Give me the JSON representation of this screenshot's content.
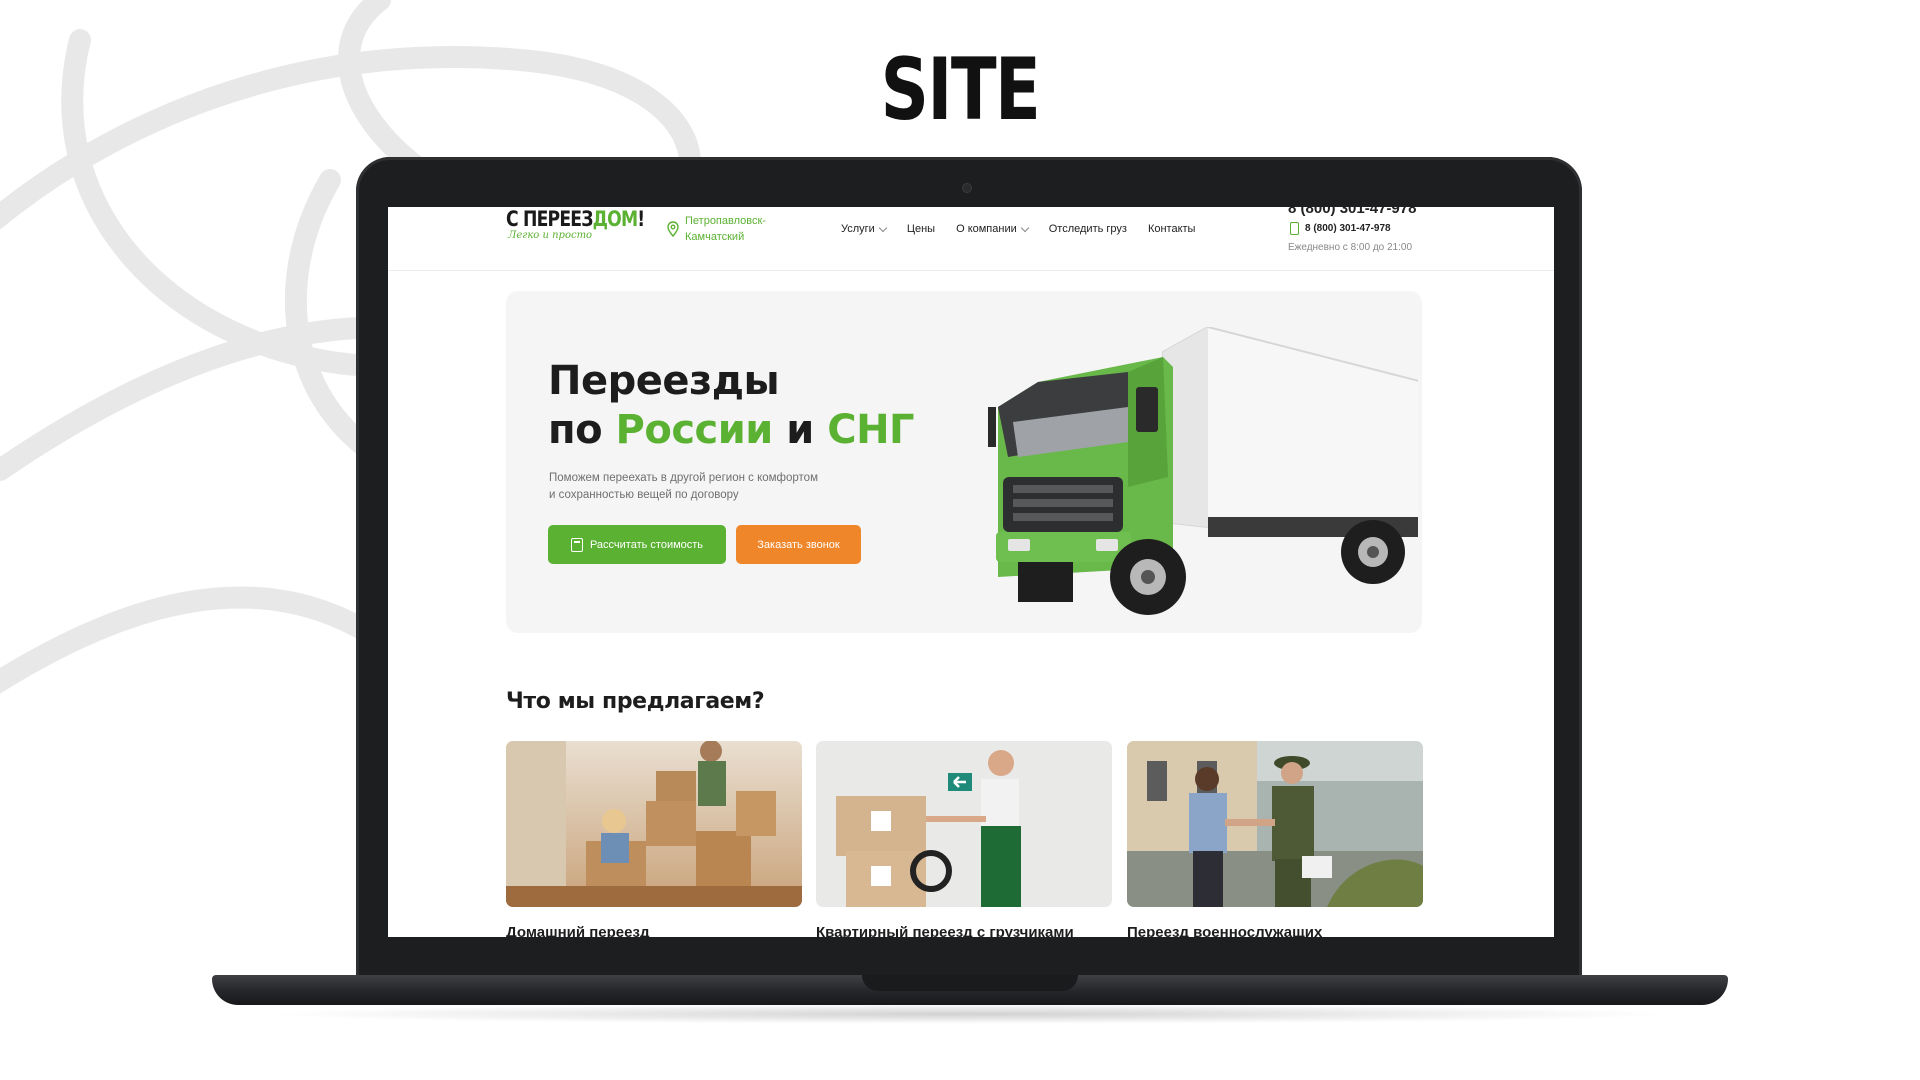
{
  "showcase": {
    "title": "SITE"
  },
  "site": {
    "logo": {
      "text_prefix": "С ПЕРЕЕЗ",
      "text_accent": "ДОМ",
      "text_suffix": "!",
      "tagline": "Легко и просто"
    },
    "location": {
      "city_line1": "Петропавловск-",
      "city_line2": "Камчатский"
    },
    "nav": [
      {
        "label": "Услуги",
        "dropdown": true
      },
      {
        "label": "Цены",
        "dropdown": false
      },
      {
        "label": "О компании",
        "dropdown": true
      },
      {
        "label": "Отследить груз",
        "dropdown": false
      },
      {
        "label": "Контакты",
        "dropdown": false
      }
    ],
    "contact": {
      "phone_main": "8 (800) 301-47-978",
      "phone_secondary": "8 (800) 301-47-978",
      "hours": "Ежедневно с 8:00 до 21:00"
    },
    "hero": {
      "title_line1": "Переезды",
      "title_line2_a": "по ",
      "title_line2_b": "России",
      "title_line2_c": " и ",
      "title_line2_d": "СНГ",
      "subtitle_line1": "Поможем переехать в другой регион с комфортом",
      "subtitle_line2": "и сохранностью вещей по договору",
      "btn_calc": "Рассчитать стоимость",
      "btn_call": "Заказать звонок"
    },
    "services": {
      "title": "Что мы предлагаем?",
      "cards": [
        {
          "title": "Домашний переезд"
        },
        {
          "title": "Квартирный переезд с грузчиками"
        },
        {
          "title": "Переезд военнослужащих"
        }
      ]
    }
  },
  "colors": {
    "accent_green": "#5bb132",
    "accent_orange": "#f0862a",
    "laptop": "#1d1e20"
  }
}
